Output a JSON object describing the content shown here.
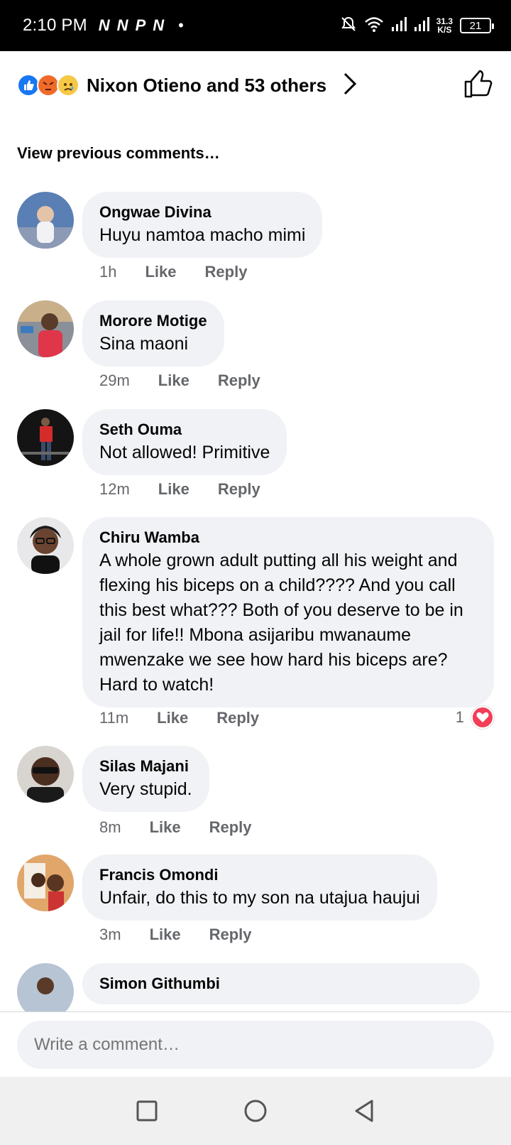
{
  "status_bar": {
    "time": "2:10 PM",
    "apps": [
      "N",
      "N",
      "P",
      "N"
    ],
    "speed_top": "31.3",
    "speed_bottom": "K/S",
    "battery": "21"
  },
  "reactions": {
    "summary": "Nixon Otieno and 53 others",
    "icons": [
      "like-icon",
      "angry-icon",
      "sad-icon"
    ]
  },
  "view_previous": "View previous comments…",
  "comments": [
    {
      "author": "Ongwae Divina",
      "text": "Huyu namtoa macho mimi",
      "time": "1h",
      "like": "Like",
      "reply": "Reply"
    },
    {
      "author": "Morore Motige",
      "text": "Sina maoni",
      "time": "29m",
      "like": "Like",
      "reply": "Reply"
    },
    {
      "author": "Seth Ouma",
      "text": "Not allowed! Primitive",
      "time": "12m",
      "like": "Like",
      "reply": "Reply"
    },
    {
      "author": "Chiru Wamba",
      "text": "A whole grown adult putting all his weight and flexing his biceps on a child???? And you call this best what??? Both of you deserve to be in jail for life!! Mbona asijaribu mwanaume mwenzake we see how hard his biceps are? Hard to watch!",
      "time": "11m",
      "like": "Like",
      "reply": "Reply",
      "reaction_count": "1"
    },
    {
      "author": "Silas Majani",
      "text": "Very stupid.",
      "time": "8m",
      "like": "Like",
      "reply": "Reply"
    },
    {
      "author": "Francis Omondi",
      "text": "Unfair, do this to my son na utajua haujui",
      "time": "3m",
      "like": "Like",
      "reply": "Reply"
    },
    {
      "author": "Simon Githumbi"
    }
  ],
  "composer": {
    "placeholder": "Write a comment…"
  },
  "colors": {
    "bubble": "#f0f2f5",
    "meta_text": "#65676b",
    "like_blue": "#1877f2",
    "heart_red": "#f33e58"
  }
}
